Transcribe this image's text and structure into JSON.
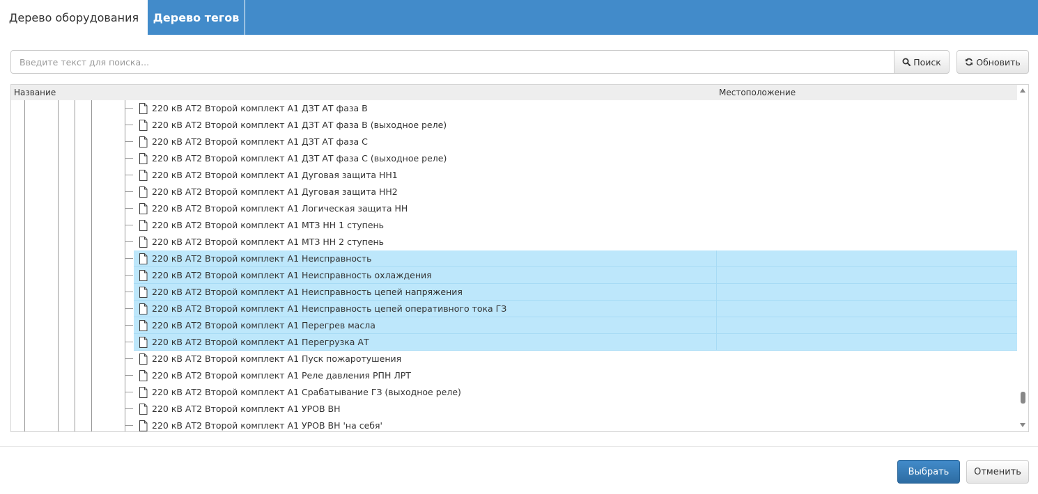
{
  "tabs": [
    {
      "label": "Дерево оборудования",
      "active": true
    },
    {
      "label": "Дерево тегов",
      "active": false
    }
  ],
  "search": {
    "placeholder": "Введите текст для поиска...",
    "value": "",
    "search_label": "Поиск",
    "refresh_label": "Обновить"
  },
  "grid": {
    "columns": [
      "Название",
      "Местоположение"
    ],
    "rows": [
      {
        "name": "220 кВ АТ2 Второй комплект А1 ДЗТ АТ фаза В",
        "location": "",
        "selected": false
      },
      {
        "name": "220 кВ АТ2 Второй комплект А1 ДЗТ АТ фаза В (выходное реле)",
        "location": "",
        "selected": false
      },
      {
        "name": "220 кВ АТ2 Второй комплект А1 ДЗТ АТ фаза С",
        "location": "",
        "selected": false
      },
      {
        "name": "220 кВ АТ2 Второй комплект А1 ДЗТ АТ фаза С (выходное реле)",
        "location": "",
        "selected": false
      },
      {
        "name": "220 кВ АТ2 Второй комплект А1 Дуговая защита НН1",
        "location": "",
        "selected": false
      },
      {
        "name": "220 кВ АТ2 Второй комплект А1 Дуговая защита НН2",
        "location": "",
        "selected": false
      },
      {
        "name": "220 кВ АТ2 Второй комплект А1 Логическая защита НН",
        "location": "",
        "selected": false
      },
      {
        "name": "220 кВ АТ2 Второй комплект А1 МТЗ НН 1 ступень",
        "location": "",
        "selected": false
      },
      {
        "name": "220 кВ АТ2 Второй комплект А1 МТЗ НН 2 ступень",
        "location": "",
        "selected": false
      },
      {
        "name": "220 кВ АТ2 Второй комплект А1 Неисправность",
        "location": "",
        "selected": true
      },
      {
        "name": "220 кВ АТ2 Второй комплект А1 Неисправность охлаждения",
        "location": "",
        "selected": true
      },
      {
        "name": "220 кВ АТ2 Второй комплект А1 Неисправность цепей напряжения",
        "location": "",
        "selected": true
      },
      {
        "name": "220 кВ АТ2 Второй комплект А1 Неисправность цепей оперативного тока ГЗ",
        "location": "",
        "selected": true
      },
      {
        "name": "220 кВ АТ2 Второй комплект А1 Перегрев масла",
        "location": "",
        "selected": true
      },
      {
        "name": "220 кВ АТ2 Второй комплект А1 Перегрузка АТ",
        "location": "",
        "selected": true
      },
      {
        "name": "220 кВ АТ2 Второй комплект А1 Пуск пожаротушения",
        "location": "",
        "selected": false
      },
      {
        "name": "220 кВ АТ2 Второй комплект А1 Реле давления РПН ЛРТ",
        "location": "",
        "selected": false
      },
      {
        "name": "220 кВ АТ2 Второй комплект А1 Срабатывание ГЗ (выходное реле)",
        "location": "",
        "selected": false
      },
      {
        "name": "220 кВ АТ2 Второй комплект А1 УРОВ ВН",
        "location": "",
        "selected": false
      },
      {
        "name": "220 кВ АТ2 Второй комплект А1 УРОВ ВН 'на себя'",
        "location": "",
        "selected": false
      }
    ]
  },
  "footer": {
    "select_label": "Выбрать",
    "cancel_label": "Отменить"
  },
  "colors": {
    "header_blue": "#428bca",
    "selection": "#bde7fb",
    "primary_button": "#337ab7"
  },
  "icons": [
    "search-icon",
    "refresh-icon",
    "file-icon",
    "scroll-up-icon",
    "scroll-down-icon"
  ]
}
